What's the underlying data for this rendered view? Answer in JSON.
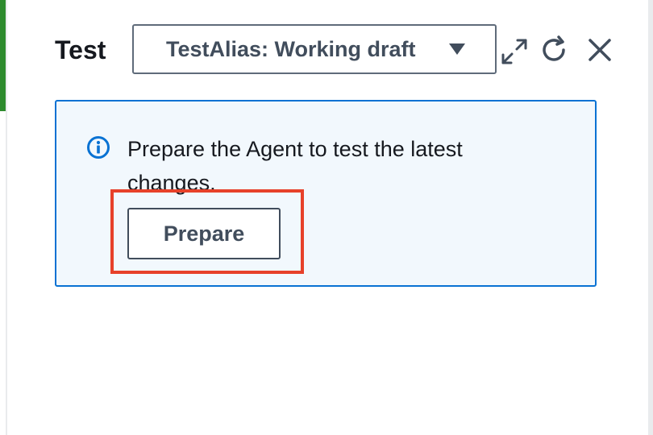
{
  "panel": {
    "title": "Test"
  },
  "alias_select": {
    "selected_value": "TestAlias: Working draft"
  },
  "toolbar": {
    "icons": [
      "expand-icon",
      "refresh-icon",
      "close-icon"
    ]
  },
  "alert": {
    "type": "info",
    "message": "Prepare the Agent to test the latest changes.",
    "button_label": "Prepare"
  },
  "colors": {
    "alert_border": "#0972d3",
    "alert_background": "#f2f8fd",
    "highlight": "#e7412a",
    "left_accent": "#2e8b2e"
  }
}
